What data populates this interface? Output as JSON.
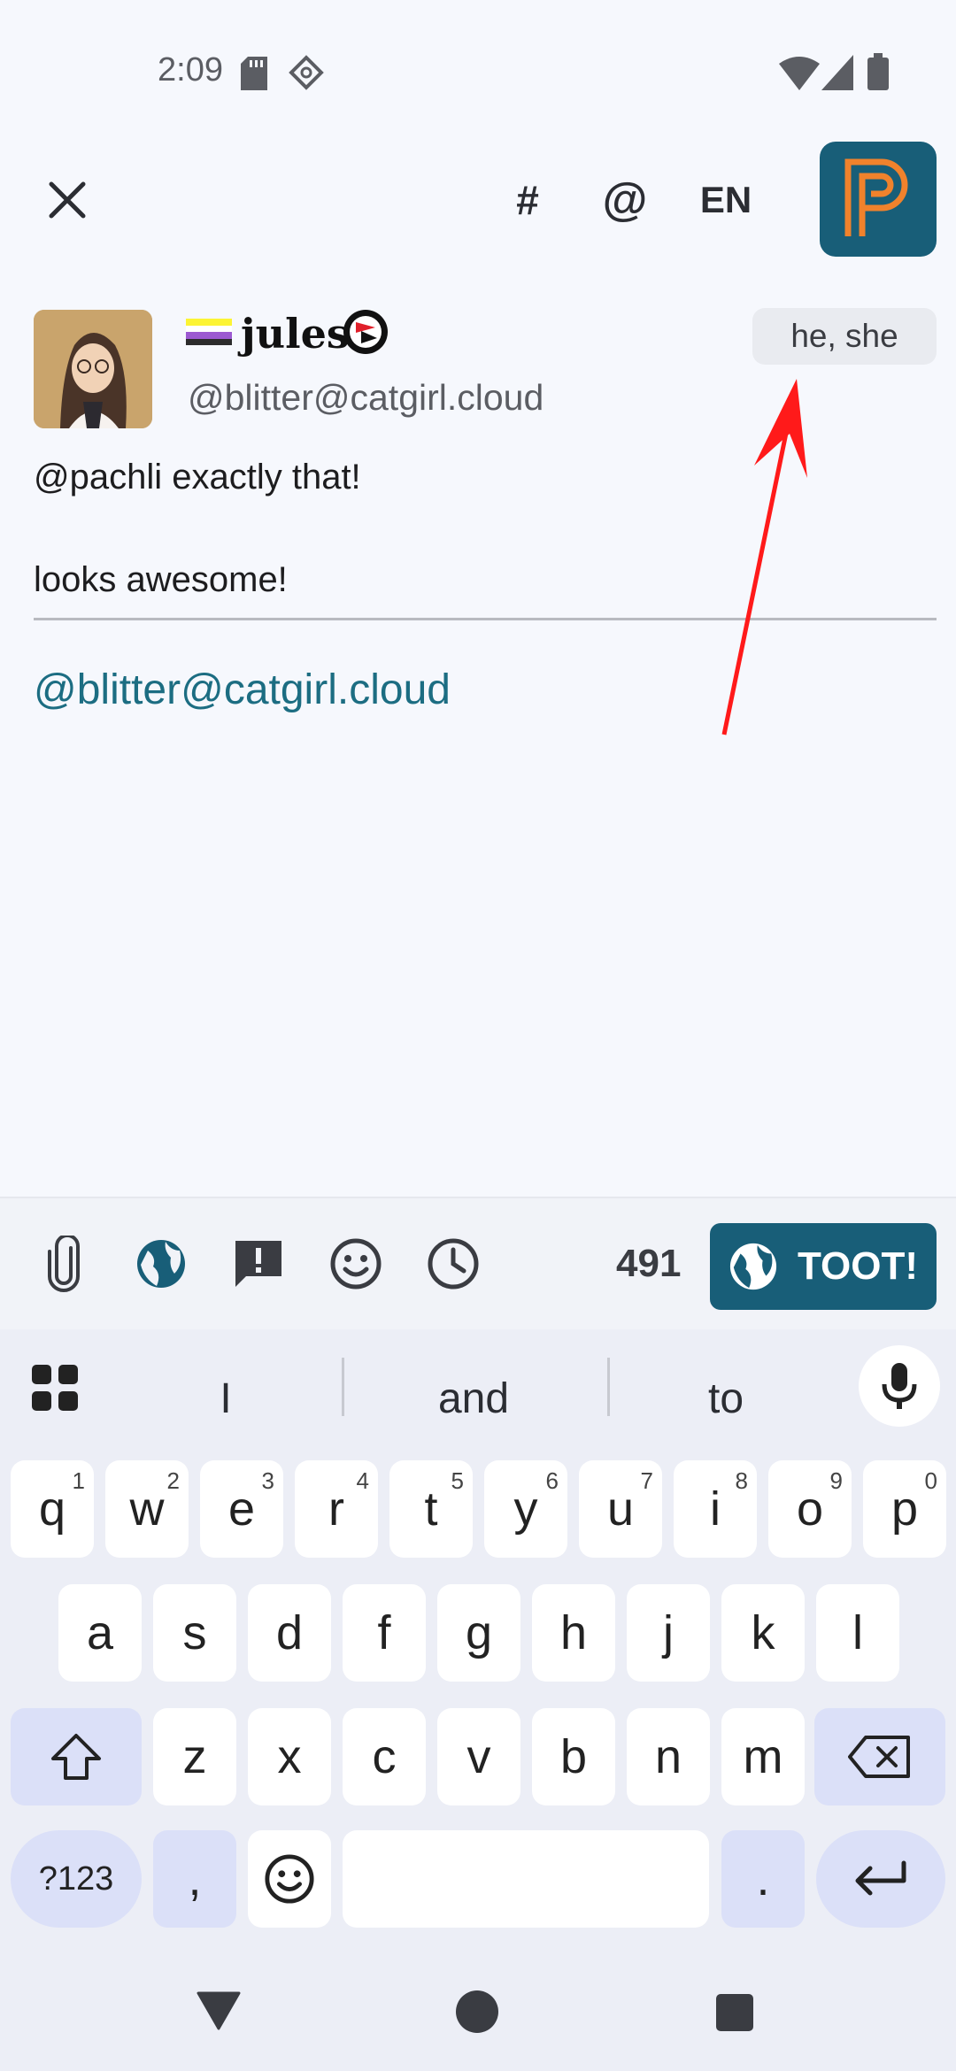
{
  "status_bar": {
    "time": "2:09"
  },
  "toolbar": {
    "close_icon": "close-icon",
    "hashtag_label": "#",
    "mention_label": "@",
    "language_label": "EN"
  },
  "reply": {
    "display_name": "jules",
    "handle": "@blitter@catgirl.cloud",
    "pronouns": "he, she",
    "text": "@pachli exactly that!\n\nlooks awesome!"
  },
  "compose": {
    "value": "@blitter@catgirl.cloud"
  },
  "compose_toolbar": {
    "char_count": "491",
    "toot_label": "TOOT!"
  },
  "keyboard": {
    "suggestions": [
      "I",
      "and",
      "to"
    ],
    "row1": [
      {
        "key": "q",
        "hint": "1"
      },
      {
        "key": "w",
        "hint": "2"
      },
      {
        "key": "e",
        "hint": "3"
      },
      {
        "key": "r",
        "hint": "4"
      },
      {
        "key": "t",
        "hint": "5"
      },
      {
        "key": "y",
        "hint": "6"
      },
      {
        "key": "u",
        "hint": "7"
      },
      {
        "key": "i",
        "hint": "8"
      },
      {
        "key": "o",
        "hint": "9"
      },
      {
        "key": "p",
        "hint": "0"
      }
    ],
    "row2": [
      "a",
      "s",
      "d",
      "f",
      "g",
      "h",
      "j",
      "k",
      "l"
    ],
    "row3": [
      "z",
      "x",
      "c",
      "v",
      "b",
      "n",
      "m"
    ],
    "symbols_label": "?123",
    "comma_label": ",",
    "period_label": "."
  },
  "colors": {
    "accent": "#185e78",
    "logo_orange": "#f0822c",
    "link": "#1c6d82",
    "annotation_arrow": "#ff1a1a"
  }
}
